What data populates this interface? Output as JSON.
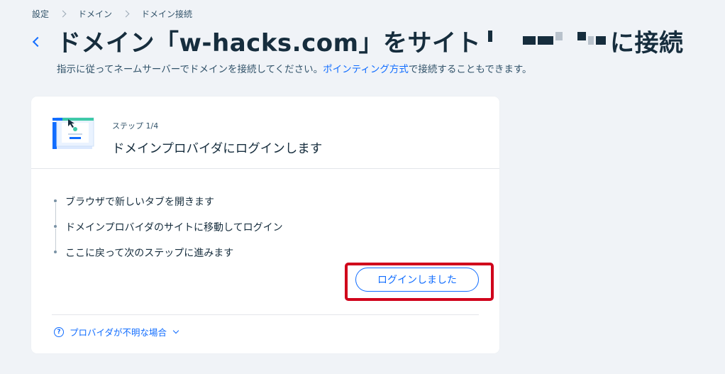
{
  "breadcrumb": [
    "設定",
    "ドメイン",
    "ドメイン接続"
  ],
  "title": {
    "prefix": "ドメイン「w-hacks.com」をサイト",
    "suffix": "に接続"
  },
  "subtitle": {
    "before": "指示に従ってネームサーバーでドメインを接続してください。",
    "link": "ポインティング方式",
    "after": "で接続することもできます。"
  },
  "step": {
    "label": "ステップ 1/4",
    "title": "ドメインプロバイダにログインします",
    "items": [
      "ブラウザで新しいタブを開きます",
      "ドメインプロバイダのサイトに移動してログイン",
      "ここに戻って次のステップに進みます"
    ],
    "button_label": "ログインしました"
  },
  "help_link": "プロバイダが不明な場合",
  "colors": {
    "accent": "#116dff",
    "highlight": "#d0021b",
    "text": "#162d3d",
    "background": "#f0f3f7"
  }
}
